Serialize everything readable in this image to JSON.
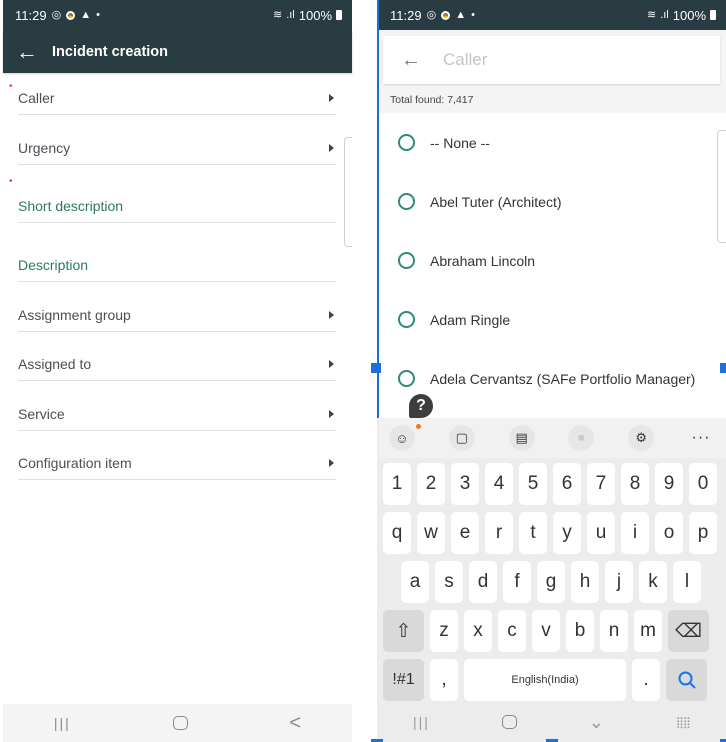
{
  "left_screen": {
    "status_bar": {
      "time": "11:29",
      "battery": "100%"
    },
    "app_bar": {
      "title": "Incident creation",
      "back_icon": "arrow-left-icon"
    },
    "fields": [
      {
        "label": "Caller",
        "required": true,
        "has_arrow": true,
        "style": "gray"
      },
      {
        "label": "Urgency",
        "required": false,
        "has_arrow": true,
        "style": "gray"
      },
      {
        "label": "Short description",
        "required": true,
        "has_arrow": false,
        "style": "teal"
      },
      {
        "label": "Description",
        "required": false,
        "has_arrow": false,
        "style": "teal"
      },
      {
        "label": "Assignment group",
        "required": false,
        "has_arrow": true,
        "style": "gray"
      },
      {
        "label": "Assigned to",
        "required": false,
        "has_arrow": true,
        "style": "gray"
      },
      {
        "label": "Service",
        "required": false,
        "has_arrow": true,
        "style": "gray"
      },
      {
        "label": "Configuration item",
        "required": false,
        "has_arrow": true,
        "style": "gray"
      }
    ],
    "required_marker": "•",
    "nav_bar": {
      "recents": "|||",
      "back": "<"
    }
  },
  "right_screen": {
    "status_bar": {
      "time": "11:29",
      "battery": "100%"
    },
    "search": {
      "placeholder": "Caller",
      "value": ""
    },
    "total_found": "Total found: 7,417",
    "options": [
      {
        "label": "-- None --",
        "selected": false
      },
      {
        "label": "Abel Tuter (Architect)",
        "selected": false
      },
      {
        "label": "Abraham Lincoln",
        "selected": false
      },
      {
        "label": "Adam Ringle",
        "selected": false
      },
      {
        "label": "Adela Cervantsz (SAFe Portfolio Manager)",
        "selected": false
      }
    ],
    "help_badge": "?",
    "keyboard": {
      "toolbar": [
        "emoji-icon",
        "clipboard-icon",
        "text-keyboard-icon",
        "microphone-icon",
        "settings-icon",
        "more-icon"
      ],
      "more_label": "···",
      "number_row": [
        "1",
        "2",
        "3",
        "4",
        "5",
        "6",
        "7",
        "8",
        "9",
        "0"
      ],
      "row1": [
        "q",
        "w",
        "e",
        "r",
        "t",
        "y",
        "u",
        "i",
        "o",
        "p"
      ],
      "row2": [
        "a",
        "s",
        "d",
        "f",
        "g",
        "h",
        "j",
        "k",
        "l"
      ],
      "row3": [
        "z",
        "x",
        "c",
        "v",
        "b",
        "n",
        "m"
      ],
      "shift": "⇧",
      "backspace": "⌫",
      "symbols": "!#1",
      "comma": ",",
      "space_label": "English(India)",
      "period": ".",
      "search_key": "⚲"
    },
    "nav_bar": {
      "recents": "|||",
      "hide_keyboard": "⌄"
    }
  },
  "colors": {
    "app_bar": "#283c42",
    "teal_label": "#2e7765",
    "required": "#e64545",
    "radio": "#2e8b7a",
    "selection": "#1e6fd9",
    "keyboard_search": "#1a73e8"
  }
}
